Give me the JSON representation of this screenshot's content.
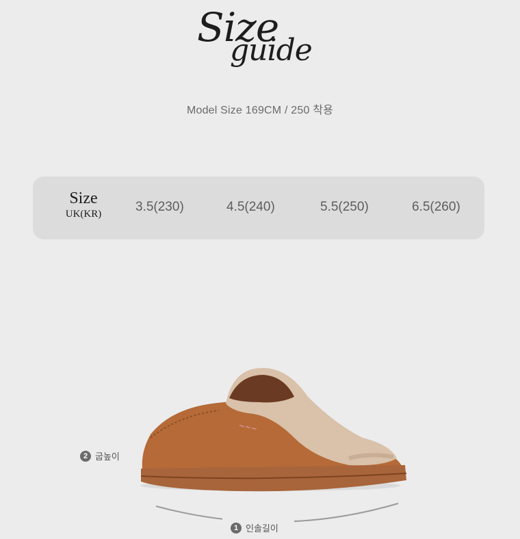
{
  "header": {
    "title_line1": "Size",
    "title_line2": "guide",
    "model_size": "Model Size 169CM / 250 착용"
  },
  "size_table": {
    "label": "Size",
    "sublabel": "UK(KR)",
    "sizes": [
      "3.5(230)",
      "4.5(240)",
      "5.5(250)",
      "6.5(260)"
    ]
  },
  "measurements": [
    {
      "number": "1",
      "label": "인솔길이"
    },
    {
      "number": "2",
      "label": "굽높이"
    }
  ],
  "product": {
    "image": "shearling-slipper",
    "colors": {
      "suede": "#b56a38",
      "fur": "#d9c1aa",
      "sole": "#a8643a"
    }
  }
}
